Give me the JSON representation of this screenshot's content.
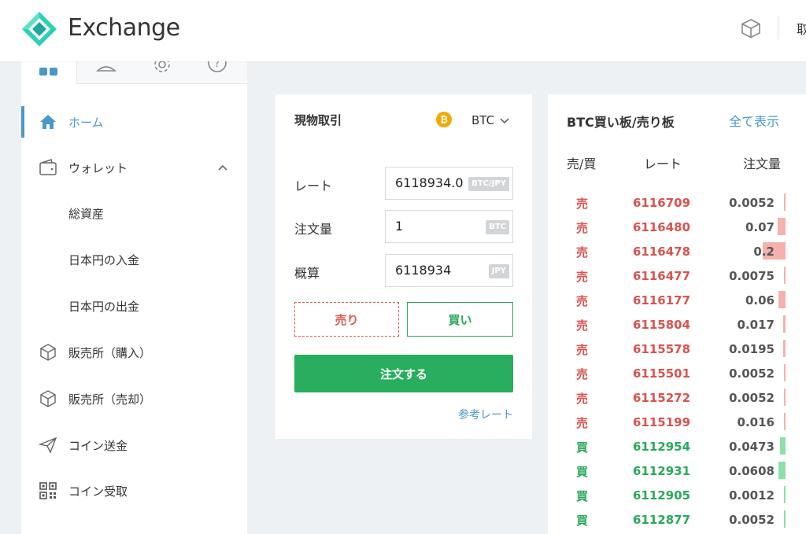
{
  "header": {
    "brand": "Exchange",
    "right_text": "取",
    "colors": {
      "logo_primary": "#2bd1b2",
      "logo_secondary": "#1fa6a0"
    }
  },
  "sidebar": {
    "tab_icons": [
      "grid-icon",
      "user-icon",
      "gear-icon",
      "help-icon"
    ],
    "items": [
      {
        "label": "ホーム",
        "icon": "home-icon",
        "active": true
      },
      {
        "label": "ウォレット",
        "icon": "wallet-icon",
        "expanded": true
      },
      {
        "label": "総資産",
        "sub": true
      },
      {
        "label": "日本円の入金",
        "sub": true
      },
      {
        "label": "日本円の出金",
        "sub": true
      },
      {
        "label": "販売所（購入）",
        "icon": "cube-icon"
      },
      {
        "label": "販売所（売却）",
        "icon": "cube-icon"
      },
      {
        "label": "コイン送金",
        "icon": "paper-plane-icon"
      },
      {
        "label": "コイン受取",
        "icon": "qr-code-icon"
      }
    ]
  },
  "trade": {
    "title": "現物取引",
    "coin_symbol": "₿",
    "coin": "BTC",
    "fields": [
      {
        "label": "レート",
        "value": "6118934.0",
        "unit": "BTC/JPY"
      },
      {
        "label": "注文量",
        "value": "1",
        "unit": "BTC"
      },
      {
        "label": "概算",
        "value": "6118934",
        "unit": "JPY"
      }
    ],
    "sell_label": "売り",
    "buy_label": "買い",
    "order_label": "注文する",
    "ref_link": "参考レート",
    "colors": {
      "sell": "#dc5a4f",
      "buy": "#2aa85a",
      "order": "#28ae5e"
    }
  },
  "orderbook": {
    "title": "BTC買い板/売り板",
    "show_all": "全て表示",
    "col_side": "売/買",
    "col_rate": "レート",
    "col_qty": "注文量",
    "rows": [
      {
        "side": "売",
        "type": "sell",
        "rate": "6116709",
        "qty": "0.0052",
        "depth": 0.02
      },
      {
        "side": "売",
        "type": "sell",
        "rate": "6116480",
        "qty": "0.07",
        "depth": 0.28
      },
      {
        "side": "売",
        "type": "sell",
        "rate": "6116478",
        "qty": "0.2",
        "depth": 0.8
      },
      {
        "side": "売",
        "type": "sell",
        "rate": "6116477",
        "qty": "0.0075",
        "depth": 0.03
      },
      {
        "side": "売",
        "type": "sell",
        "rate": "6116177",
        "qty": "0.06",
        "depth": 0.24
      },
      {
        "side": "売",
        "type": "sell",
        "rate": "6115804",
        "qty": "0.017",
        "depth": 0.07
      },
      {
        "side": "売",
        "type": "sell",
        "rate": "6115578",
        "qty": "0.0195",
        "depth": 0.08
      },
      {
        "side": "売",
        "type": "sell",
        "rate": "6115501",
        "qty": "0.0052",
        "depth": 0.02
      },
      {
        "side": "売",
        "type": "sell",
        "rate": "6115272",
        "qty": "0.0052",
        "depth": 0.02
      },
      {
        "side": "売",
        "type": "sell",
        "rate": "6115199",
        "qty": "0.016",
        "depth": 0.06
      },
      {
        "side": "買",
        "type": "buy",
        "rate": "6112954",
        "qty": "0.0473",
        "depth": 0.19
      },
      {
        "side": "買",
        "type": "buy",
        "rate": "6112931",
        "qty": "0.0608",
        "depth": 0.24
      },
      {
        "side": "買",
        "type": "buy",
        "rate": "6112905",
        "qty": "0.0012",
        "depth": 0.01
      },
      {
        "side": "買",
        "type": "buy",
        "rate": "6112877",
        "qty": "0.0052",
        "depth": 0.02
      }
    ]
  }
}
